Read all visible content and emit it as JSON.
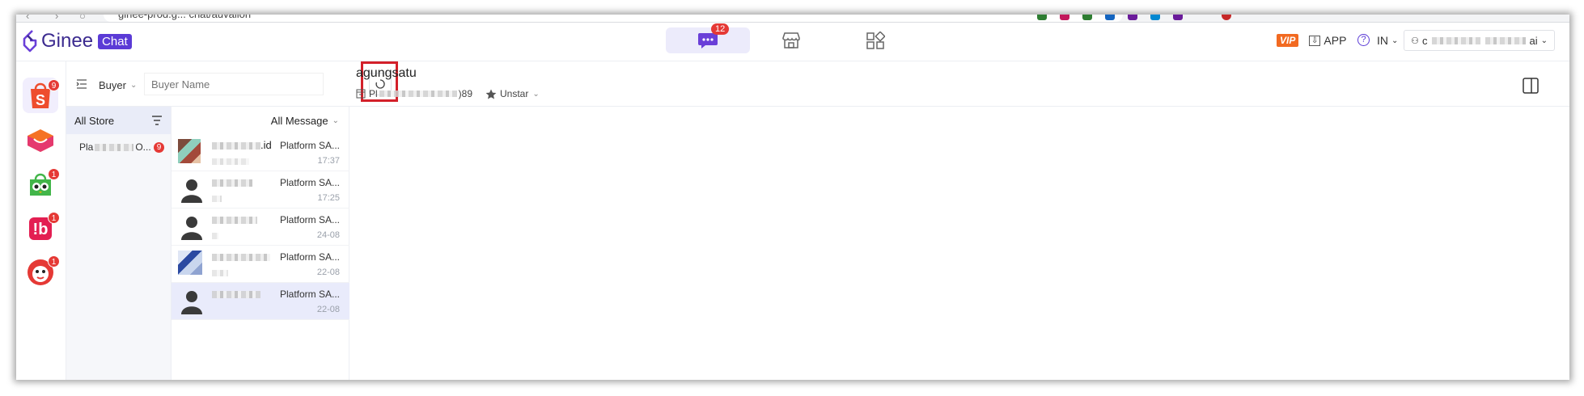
{
  "browser": {
    "url": "ginee-prod.g... chat/auvalion",
    "extension_colors": [
      "#2e7d32",
      "#c2185b",
      "#2e7d32",
      "#1565c0",
      "#6a1b9a",
      "#0288d1",
      "#6a1b9a",
      "#9e9e9e",
      "#9e9e9e",
      "#c62828"
    ]
  },
  "header": {
    "brand": "Ginee",
    "brand_chat": "Chat",
    "chat_badge": "12",
    "vip": "VIP",
    "app_label": "APP",
    "lang": "IN",
    "user_prefix": "c",
    "user_suffix": "ai"
  },
  "platforms": [
    {
      "name": "shopee",
      "badge": "9",
      "color": "#ee4d2d"
    },
    {
      "name": "lazada",
      "badge": "",
      "color": "#f57224"
    },
    {
      "name": "tokopedia",
      "badge": "1",
      "color": "#42b549"
    },
    {
      "name": "bukalapak",
      "badge": "1",
      "color": "#e31e52"
    },
    {
      "name": "blibli",
      "badge": "1",
      "color": "#e53935"
    }
  ],
  "filter": {
    "buyer_select": "Buyer",
    "search_placeholder": "Buyer Name"
  },
  "stores": {
    "heading": "All Store",
    "items": [
      {
        "prefix": "Pla",
        "suffix": "O...",
        "badge": "9"
      }
    ]
  },
  "messages": {
    "filter": "All Message",
    "rows": [
      {
        "name_suffix": ".id",
        "platform": "Platform SA...",
        "time": "17:37"
      },
      {
        "name_suffix": "",
        "platform": "Platform SA...",
        "time": "17:25"
      },
      {
        "name_suffix": "",
        "platform": "Platform SA...",
        "time": "24-08"
      },
      {
        "name_suffix": "",
        "platform": "Platform SA...",
        "time": "22-08"
      },
      {
        "name_suffix": "",
        "platform": "Platform SA...",
        "time": "22-08"
      }
    ]
  },
  "chat": {
    "buyer": "agungsatu",
    "store_prefix": "Pl",
    "store_suffix": ")89",
    "star_label": "Unstar"
  }
}
